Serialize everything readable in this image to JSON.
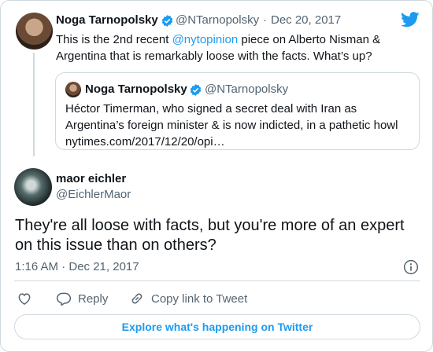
{
  "parent_tweet": {
    "author_name": "Noga Tarnopolsky",
    "handle": "@NTarnopolsky",
    "separator": "·",
    "date": "Dec 20, 2017",
    "text_before": "This is the 2nd recent ",
    "mention": "@nytopinion",
    "text_after": " piece on Alberto Nisman & Argentina that is remarkably loose with the facts. What’s up?"
  },
  "quoted_tweet": {
    "author_name": "Noga Tarnopolsky",
    "handle": "@NTarnopolsky",
    "line1": "Héctor Timerman, who signed a secret deal with Iran as",
    "line2": "Argentina’s foreign minister & is now indicted, in a pathetic howl",
    "line3": "nytimes.com/2017/12/20/opi…"
  },
  "main_tweet": {
    "author_name": "maor eichler",
    "handle": "@EichlerMaor",
    "text": "They're all loose with facts, but you're more of an expert on this issue than on others?",
    "timestamp": "1:16 AM · Dec 21, 2017"
  },
  "actions": {
    "reply": "Reply",
    "copy_link": "Copy link to Tweet"
  },
  "explore_label": "Explore what's happening on Twitter",
  "colors": {
    "accent": "#1d9bf0",
    "text": "#0f1419",
    "secondary": "#536471",
    "border": "#cfd9de"
  },
  "icons": [
    "twitter-bird-icon",
    "verified-badge-icon",
    "info-icon",
    "heart-icon",
    "reply-icon",
    "link-icon"
  ]
}
